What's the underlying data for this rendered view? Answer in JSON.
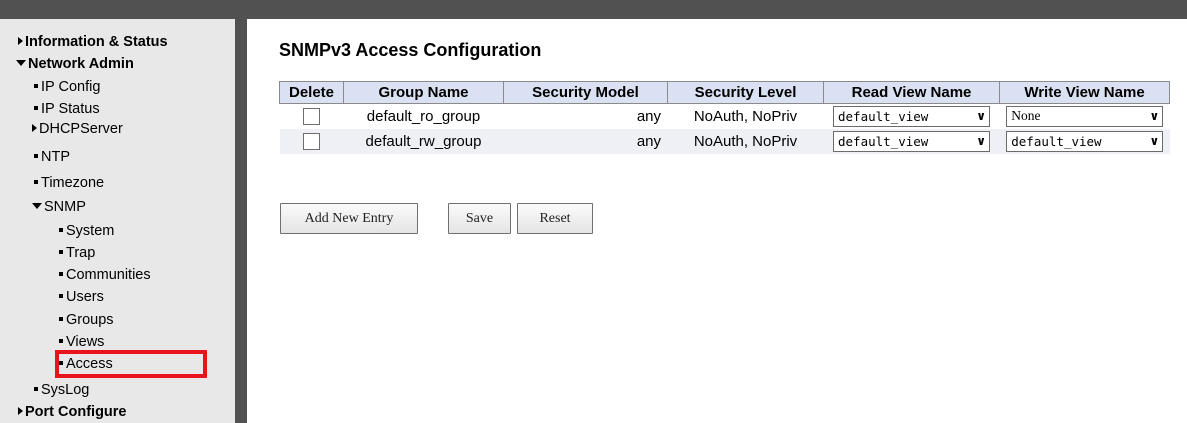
{
  "sidebar": {
    "items": [
      {
        "label": "Information & Status"
      },
      {
        "label": "Network Admin"
      },
      {
        "label": "IP Config"
      },
      {
        "label": "IP Status"
      },
      {
        "label": "DHCPServer"
      },
      {
        "label": "NTP"
      },
      {
        "label": "Timezone"
      },
      {
        "label": "SNMP"
      },
      {
        "label": "System"
      },
      {
        "label": "Trap"
      },
      {
        "label": "Communities"
      },
      {
        "label": "Users"
      },
      {
        "label": "Groups"
      },
      {
        "label": "Views"
      },
      {
        "label": "Access"
      },
      {
        "label": "SysLog"
      },
      {
        "label": "Port Configure"
      }
    ]
  },
  "main": {
    "title": "SNMPv3 Access Configuration",
    "columns": [
      "Delete",
      "Group Name",
      "Security Model",
      "Security Level",
      "Read View Name",
      "Write View Name"
    ],
    "rows": [
      {
        "group": "default_ro_group",
        "model": "any",
        "level": "NoAuth, NoPriv",
        "read_view": "default_view",
        "write_view": "None"
      },
      {
        "group": "default_rw_group",
        "model": "any",
        "level": "NoAuth, NoPriv",
        "read_view": "default_view",
        "write_view": "default_view"
      }
    ],
    "buttons": {
      "add": "Add New Entry",
      "save": "Save",
      "reset": "Reset"
    }
  },
  "colors": {
    "highlight": "#e8141a",
    "header_bg": "#d9e1f2",
    "sidebar_bg": "#e8e8e8",
    "frame": "#515151"
  }
}
